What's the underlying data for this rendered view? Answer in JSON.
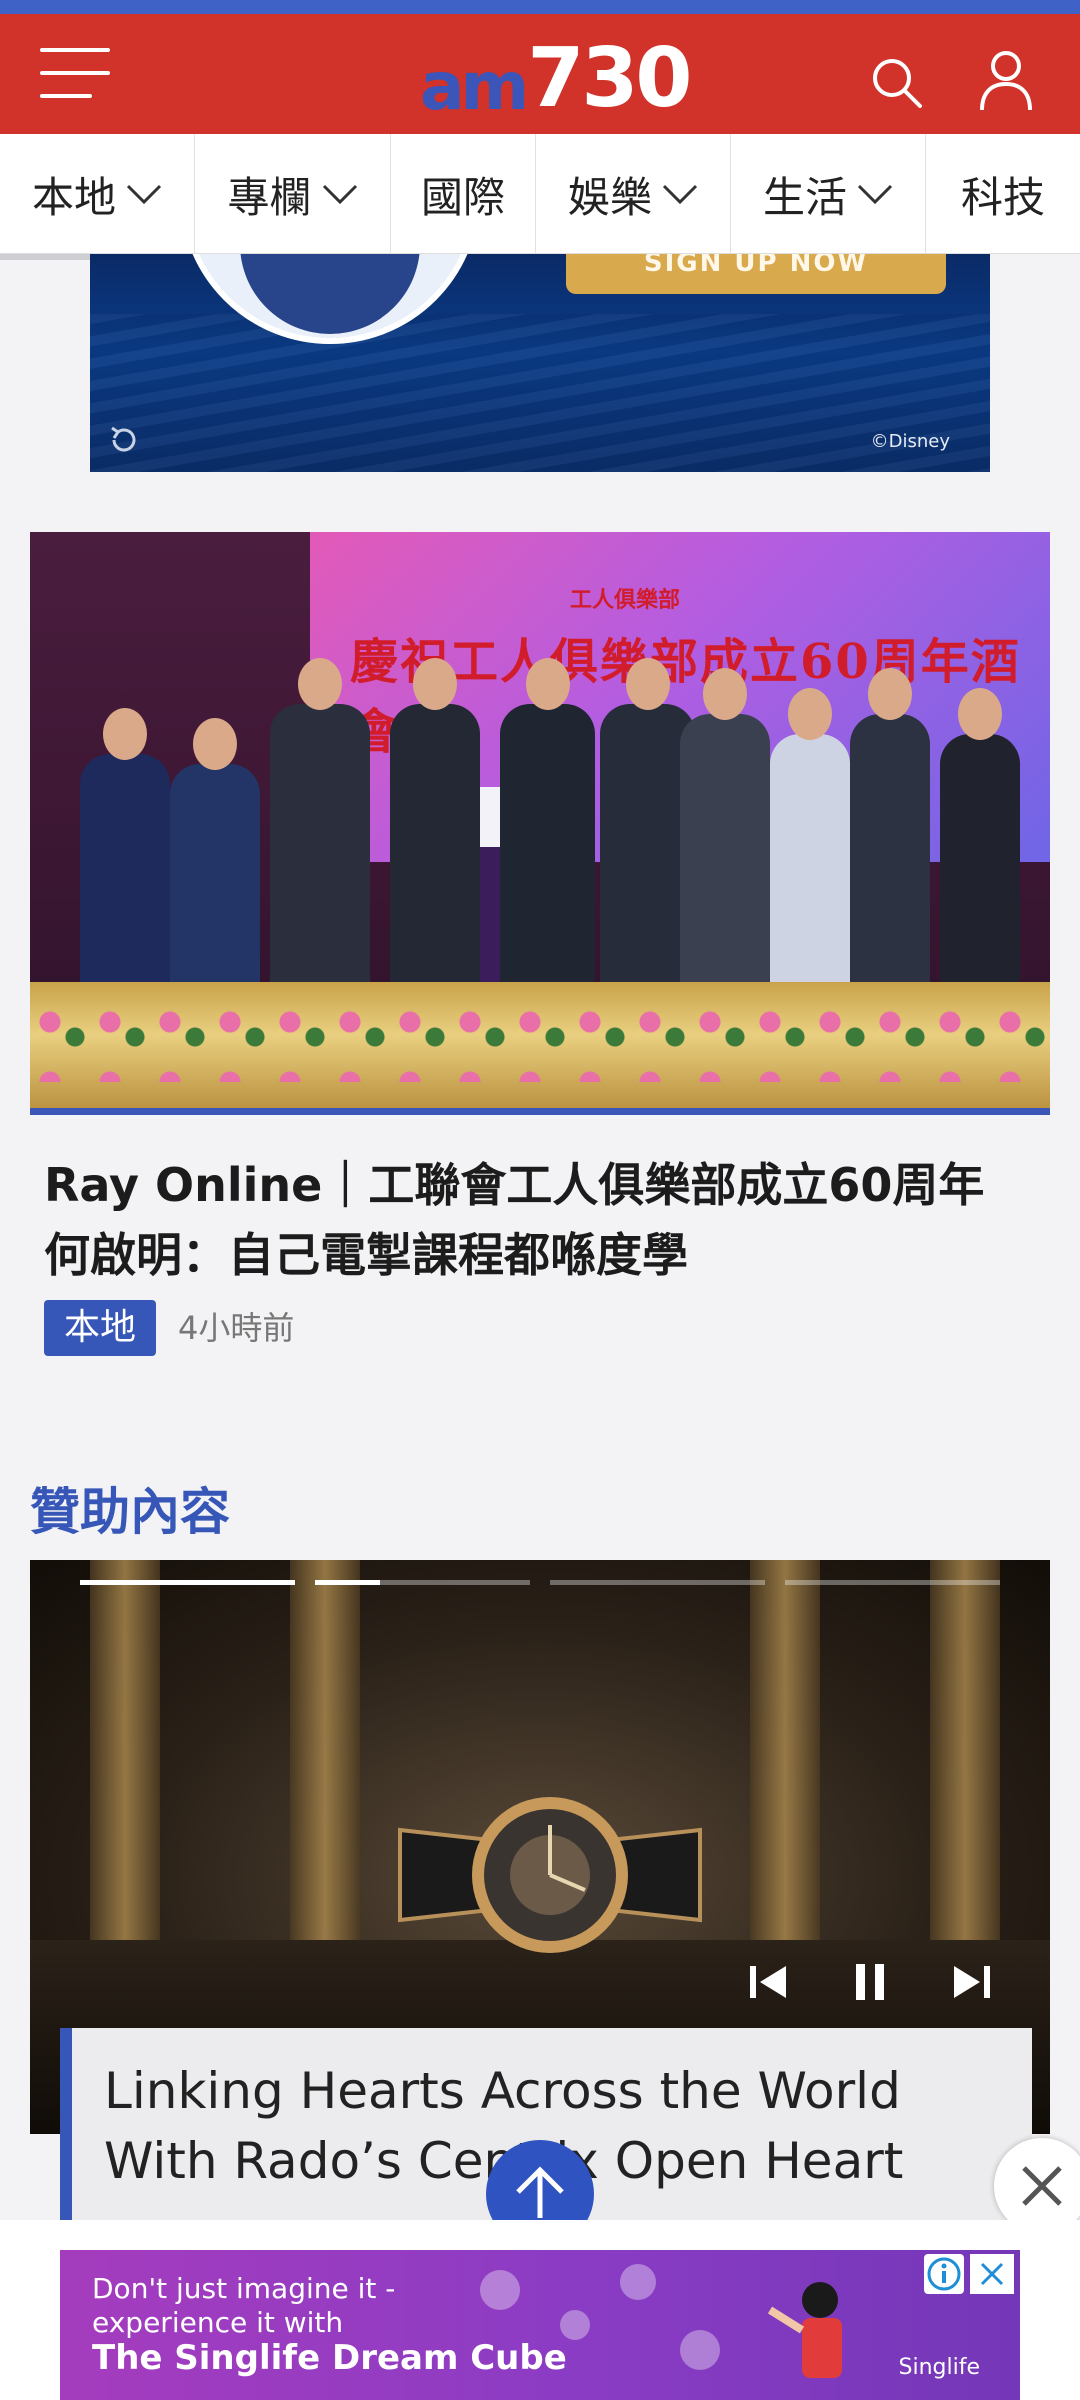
{
  "header": {
    "logo_am": "am",
    "logo_num": "730",
    "colors": {
      "bar": "#d1322a",
      "stripe": "#3f62c6",
      "logo_am": "#3b55b8"
    },
    "icons": [
      "menu-icon",
      "search-icon",
      "user-icon"
    ]
  },
  "nav": {
    "items": [
      {
        "label": "本地",
        "has_dropdown": true
      },
      {
        "label": "專欄",
        "has_dropdown": true
      },
      {
        "label": "國際",
        "has_dropdown": false
      },
      {
        "label": "娛樂",
        "has_dropdown": true
      },
      {
        "label": "生活",
        "has_dropdown": true
      },
      {
        "label": "科技",
        "has_dropdown": false
      }
    ]
  },
  "ad_top": {
    "cta": "SIGN UP NOW",
    "copyright": "©Disney"
  },
  "article": {
    "image_banner_logo": "工人俱樂部",
    "image_banner_title": "慶祝工人俱樂部成立60周年酒會",
    "title": "Ray Online｜工聯會工人俱樂部成立60周年 何啟明：自己電掣課程都喺度學",
    "tag": "本地",
    "time": "4小時前"
  },
  "sponsored": {
    "heading": "贊助內容",
    "slides_total": 4,
    "slide_progress": [
      1,
      0.3,
      0,
      0
    ],
    "caption": "Linking Hearts Across the World With Rado’s Centrix Open Heart",
    "watch_brand": "RADO"
  },
  "ad_bottom": {
    "line1": "Don't just imagine it -",
    "line1b": "experience it with",
    "line2": "The Singlife Dream Cube",
    "brand": "Singlife"
  }
}
